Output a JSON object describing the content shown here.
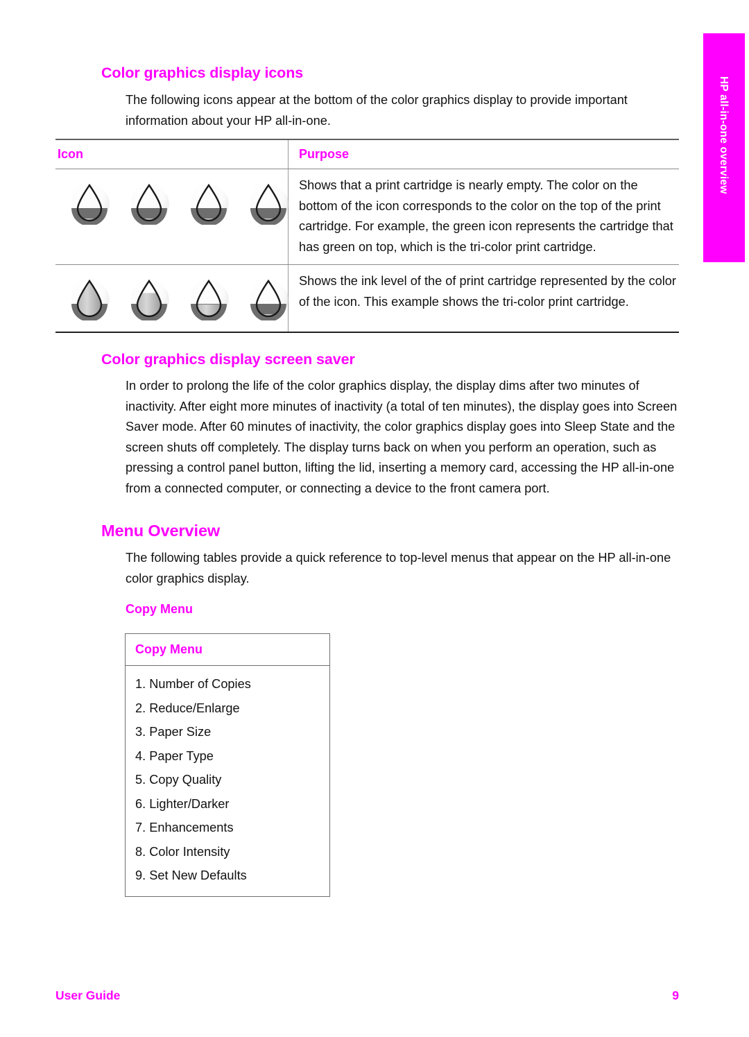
{
  "side_tab": {
    "label": "HP all-in-one overview",
    "background": "#ff00ff",
    "text_color": "#ffffff"
  },
  "accent_color": "#ff00ff",
  "sections": {
    "icons_section": {
      "heading": "Color graphics display icons",
      "intro": "The following icons appear at the bottom of the color graphics display to provide important information about your HP all-in-one.",
      "table": {
        "headers": [
          "Icon",
          "Purpose"
        ],
        "rows": [
          {
            "icon_label": "nearly-empty-cartridge-icons",
            "icon_count": 4,
            "icon_fill_levels": [
              0,
              0,
              0,
              0
            ],
            "purpose": "Shows that a print cartridge is nearly empty. The color on the bottom of the icon corresponds to the color on the top of the print cartridge. For example, the green icon represents the cartridge that has green on top, which is the tri-color print cartridge."
          },
          {
            "icon_label": "ink-level-icons",
            "icon_count": 4,
            "icon_fill_levels": [
              100,
              65,
              30,
              0
            ],
            "purpose": "Shows the ink level of the of print cartridge represented by the color of the icon. This example shows the tri-color print cartridge."
          }
        ]
      }
    },
    "screen_saver_section": {
      "heading": "Color graphics display screen saver",
      "body": "In order to prolong the life of the color graphics display, the display dims after two minutes of inactivity. After eight more minutes of inactivity (a total of ten minutes), the display goes into Screen Saver mode. After 60 minutes of inactivity, the color graphics display goes into Sleep State and the screen shuts off completely. The display turns back on when you perform an operation, such as pressing a control panel button, lifting the lid, inserting a memory card, accessing the HP all-in-one from a connected computer, or connecting a device to the front camera port."
    },
    "menu_overview_section": {
      "heading": "Menu Overview",
      "body": "The following tables provide a quick reference to top-level menus that appear on the HP all-in-one color graphics display.",
      "subheading": "Copy Menu",
      "menu_box": {
        "title": "Copy Menu",
        "items": [
          "1. Number of Copies",
          "2. Reduce/Enlarge",
          "3. Paper Size",
          "4. Paper Type",
          "5. Copy Quality",
          "6. Lighter/Darker",
          "7. Enhancements",
          "8. Color Intensity",
          "9. Set New Defaults"
        ]
      }
    }
  },
  "footer": {
    "left": "User Guide",
    "page_number": "9"
  }
}
